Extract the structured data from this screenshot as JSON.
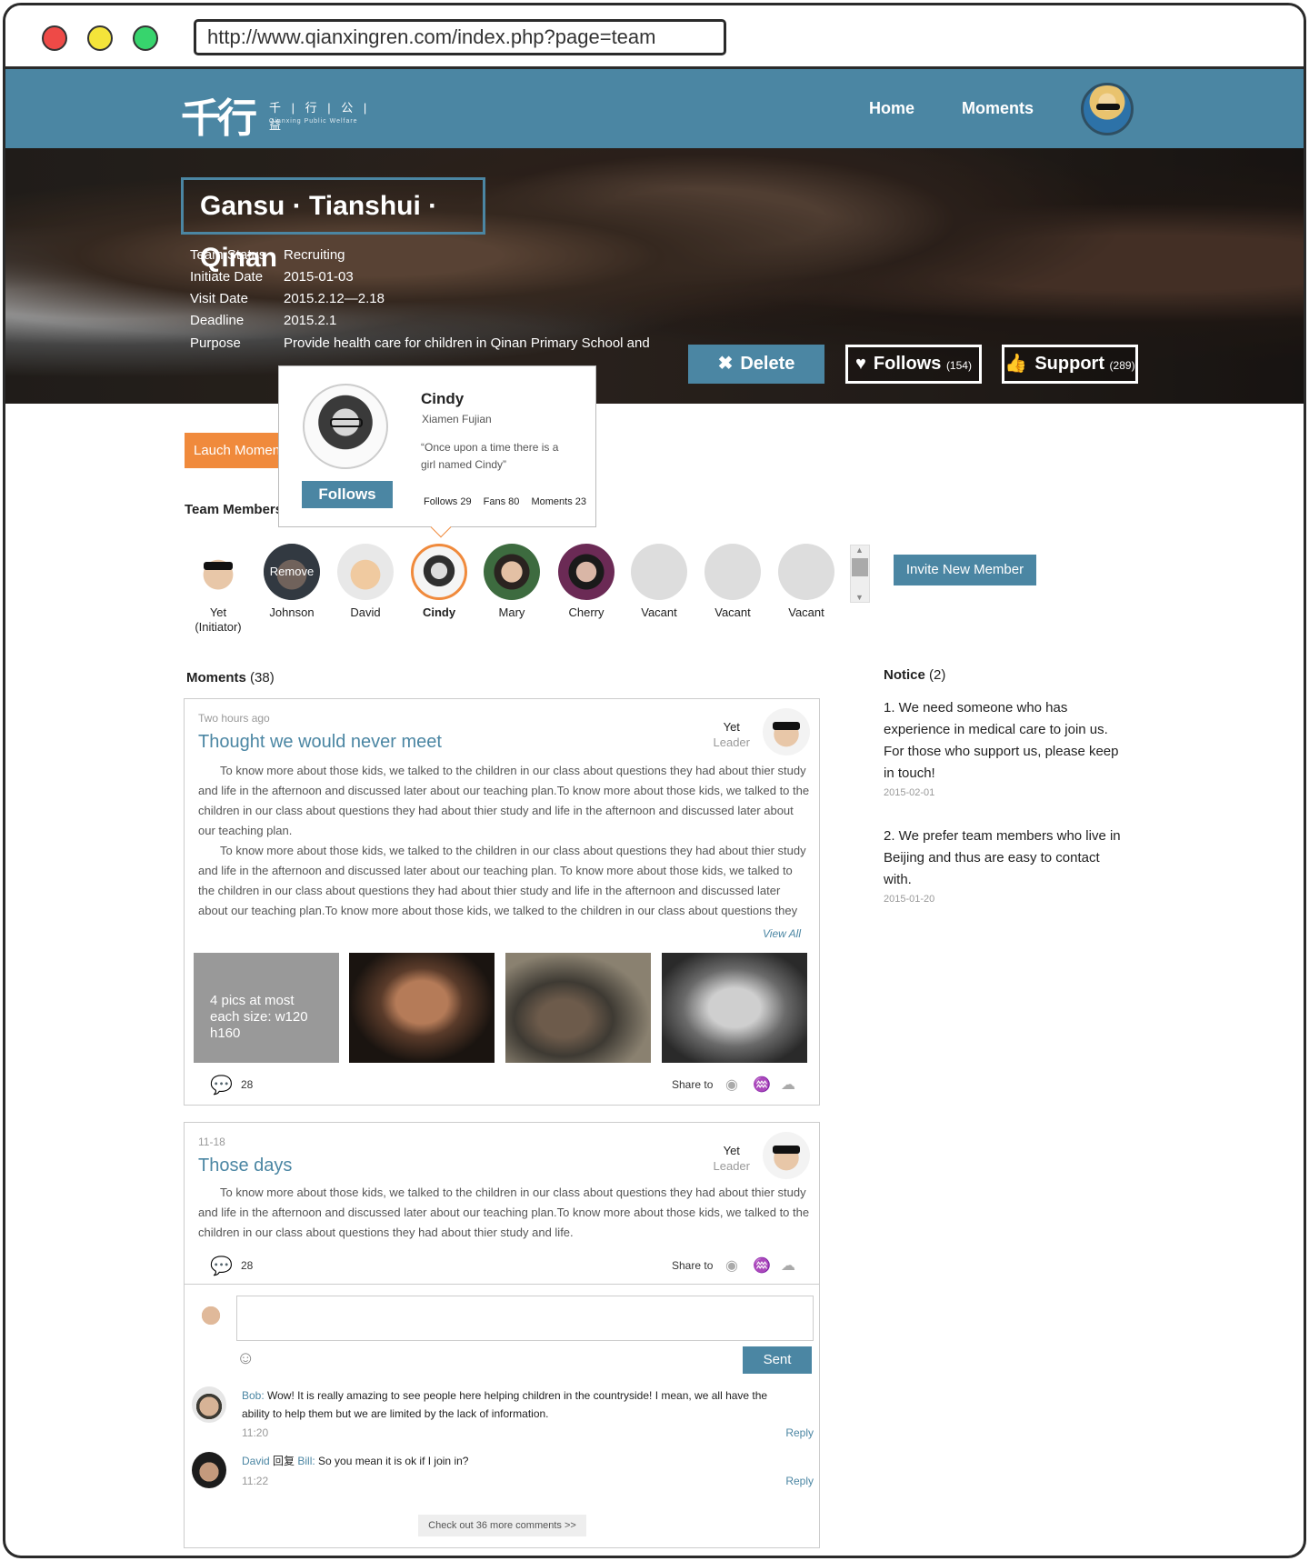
{
  "browser": {
    "url": "http://www.qianxingren.com/index.php?page=team"
  },
  "nav": {
    "logo_mark": "千行",
    "logo_cn": "千 | 行 | 公 | 益",
    "logo_en": "Qianxing Public Welfare",
    "home": "Home",
    "moments": "Moments"
  },
  "hero": {
    "title": "Gansu · Tianshui · Qinan",
    "info": {
      "status_label": "Team Status",
      "status_value": "Recruiting",
      "initiate_label": "Initiate Date",
      "initiate_value": "2015-01-03",
      "visit_label": "Visit Date",
      "visit_value": "2015.2.12—2.18",
      "deadline_label": "Deadline",
      "deadline_value": "2015.2.1",
      "purpose_label": "Purpose",
      "purpose_value": "Provide health care for children in Qinan Primary School and"
    },
    "delete_label": "Delete",
    "follows_label": "Follows",
    "follows_count": "(154)",
    "support_label": "Support",
    "support_count": "(289)"
  },
  "launch_moment": "Lauch Moment",
  "team_label": "Team Members",
  "popup": {
    "name": "Cindy",
    "place": "Xiamen Fujian",
    "quote": "“Once upon a time there is a girl named Cindy”",
    "follows_btn": "Follows",
    "follows": "Follows 29",
    "fans": "Fans 80",
    "moments": "Moments 23"
  },
  "members": [
    {
      "name": "Yet\n(Initiator)"
    },
    {
      "name": "Johnson",
      "overlay": "Remove"
    },
    {
      "name": "David"
    },
    {
      "name": "Cindy"
    },
    {
      "name": "Mary"
    },
    {
      "name": "Cherry"
    },
    {
      "name": "Vacant"
    },
    {
      "name": "Vacant"
    },
    {
      "name": "Vacant"
    }
  ],
  "invite_label": "Invite New Member",
  "moments_head": {
    "label": "Moments",
    "count": "(38)"
  },
  "notice": {
    "label": "Notice",
    "count": "(2)",
    "items": [
      {
        "text": "1. We need someone who has experience in medical care to join us. For those who support us, please keep in touch!",
        "date": "2015-02-01"
      },
      {
        "text": "2. We prefer team members who live in Beijing and thus are easy to contact with.",
        "date": "2015-01-20"
      }
    ]
  },
  "moment1": {
    "time": "Two hours ago",
    "title": "Thought we would never meet",
    "author": "Yet",
    "role": "Leader",
    "p1": "To know more about those kids, we talked to the children in our class about questions they had about thier study and life in the afternoon and discussed later about our teaching plan.To know more about those kids, we talked to the children in our class about questions they had about thier study and life in the afternoon and discussed later about our teaching plan.",
    "p2": "To know more about those kids, we talked to the children in our class about questions they had about thier study and life in the afternoon and discussed later about our teaching plan. To know more about those kids, we talked to the children in our class about questions they had about thier study and life in the afternoon and discussed later about our teaching plan.To know more about those kids, we talked to the children in our class about questions they had about thier study and life in the afternoon and discussed later about our teaching plan.To know more about ......",
    "view_all": "View All",
    "pic_note": "4 pics at most\neach size: w120 h160",
    "comments": "28",
    "share": "Share to"
  },
  "moment2": {
    "time": "11-18",
    "title": "Those days",
    "author": "Yet",
    "role": "Leader",
    "p1": "To know more about those kids, we talked to the children in our class about questions they had about thier study and life in the afternoon and discussed later about our teaching plan.To know more about those kids, we talked to the children in our class about questions they had about thier study and life.",
    "comments": "28",
    "share": "Share to",
    "sent": "Sent",
    "replies": [
      {
        "user": "Bob:",
        "text": " Wow! It is really amazing to see people here helping children in the countryside! I mean, we all have the ability to help them but we are limited by the lack of information.",
        "time": "11:20",
        "reply": "Reply"
      },
      {
        "user": "David",
        "mid": " 回复 ",
        "user2": "Bill:",
        "text": " So you mean it is ok if I join in?",
        "time": "11:22",
        "reply": "Reply"
      }
    ],
    "more": "Check out 36 more comments >>"
  },
  "icons": {
    "delete": "close-icon",
    "follows": "heart-icon",
    "support": "thumbs-up-icon",
    "comment": "comment-icon",
    "weibo": "weibo-icon",
    "renren": "renren-icon",
    "wechat": "wechat-icon",
    "emoji": "smiley-icon"
  },
  "colors": {
    "primary": "#4b86a3",
    "accent": "#f08a3c"
  }
}
